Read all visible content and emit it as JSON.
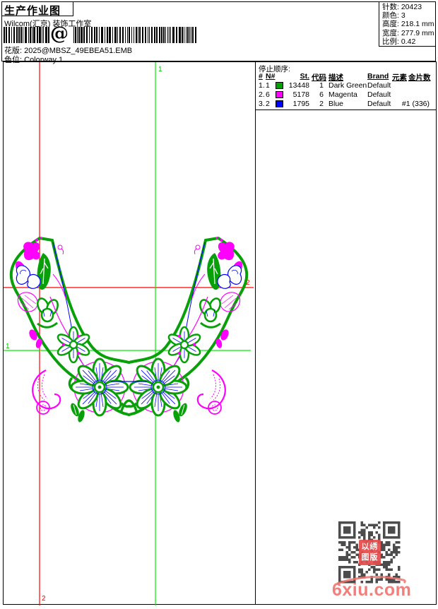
{
  "header": {
    "title": "生产作业图",
    "subtitle": "Wilcom(汇京) 装饰工作室",
    "barcode_at": "@",
    "pattern_label": "花版:",
    "pattern_value": "2025@MBSZ_49EBEA51.EMB",
    "colorway_label": "色位:",
    "colorway_value": "Colorway 1"
  },
  "stats": [
    {
      "label": "针数:",
      "value": "20423"
    },
    {
      "label": "颜色:",
      "value": "3"
    },
    {
      "label": "高度:",
      "value": "218.1 mm"
    },
    {
      "label": "宽度:",
      "value": "277.9 mm"
    },
    {
      "label": "比例:",
      "value": "0.42"
    }
  ],
  "stop_sequence": {
    "title": "停止顺序:",
    "columns": [
      "#",
      "N#",
      "St.",
      "代码",
      "描述",
      "Brand",
      "元素",
      "金片数"
    ],
    "rows": [
      {
        "idx": "1.",
        "n0": "1",
        "chip": "#00a000",
        "st": "13448",
        "code": "1",
        "desc": "Dark Green",
        "brand": "Default",
        "elements": "",
        "sequins": ""
      },
      {
        "idx": "2.",
        "n0": "6",
        "chip": "#ff00ff",
        "st": "5178",
        "code": "6",
        "desc": "Magenta",
        "brand": "Default",
        "elements": "",
        "sequins": ""
      },
      {
        "idx": "3.",
        "n0": "2",
        "chip": "#0000ff",
        "st": "1795",
        "code": "2",
        "desc": "Blue",
        "brand": "Default",
        "elements": "",
        "sequins": "#1 (336)"
      }
    ]
  },
  "canvas": {
    "labels": {
      "green_vertical": "1",
      "green_horizontal": "1",
      "red_horizontal": "2",
      "red_vertical": "2"
    },
    "colors": {
      "design_green": "#08a008",
      "magenta": "#ff00ff",
      "blue": "#0000ff",
      "cross_red": "#ff0000",
      "cross_green": "#00ee00"
    }
  },
  "watermark": {
    "site": "6xiu.com",
    "stamp_line1": "以绣",
    "stamp_line2": "图版"
  }
}
